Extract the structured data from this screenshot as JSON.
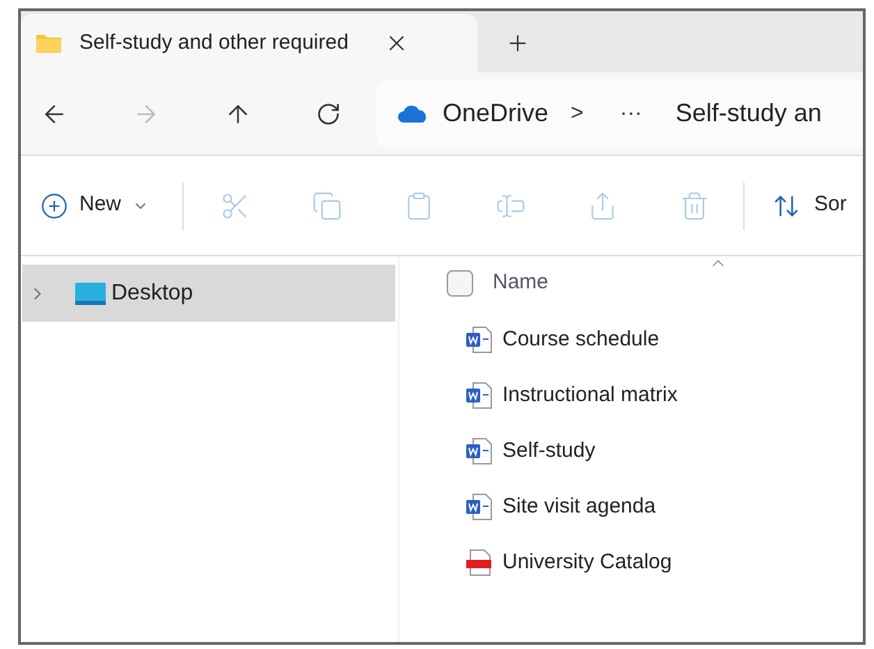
{
  "tab": {
    "title": "Self-study and other required",
    "selected": true
  },
  "navigation": {
    "forward_disabled": true
  },
  "address_bar": {
    "segments": [
      {
        "kind": "location",
        "label": "OneDrive"
      },
      {
        "kind": "separator",
        "label": ">"
      },
      {
        "kind": "ellipsis",
        "label": "···"
      },
      {
        "kind": "folder",
        "label": "Self-study an"
      }
    ]
  },
  "toolbar": {
    "new_label": "New",
    "actions": [
      {
        "disabled": true
      },
      {
        "disabled": true
      },
      {
        "disabled": true
      },
      {
        "disabled": true
      },
      {
        "disabled": true
      },
      {
        "disabled": true
      }
    ],
    "sort_label": "Sor"
  },
  "sidebar": {
    "items": [
      {
        "label": "Desktop",
        "selected": true,
        "expanded": false
      }
    ]
  },
  "file_list": {
    "column": "Name",
    "select_all_checked": false,
    "files": [
      {
        "kind": "word",
        "name": "Course schedule"
      },
      {
        "kind": "word",
        "name": "Instructional matrix"
      },
      {
        "kind": "word",
        "name": "Self-study"
      },
      {
        "kind": "word",
        "name": "Site visit agenda"
      },
      {
        "kind": "pdf",
        "name": "University Catalog"
      }
    ]
  }
}
